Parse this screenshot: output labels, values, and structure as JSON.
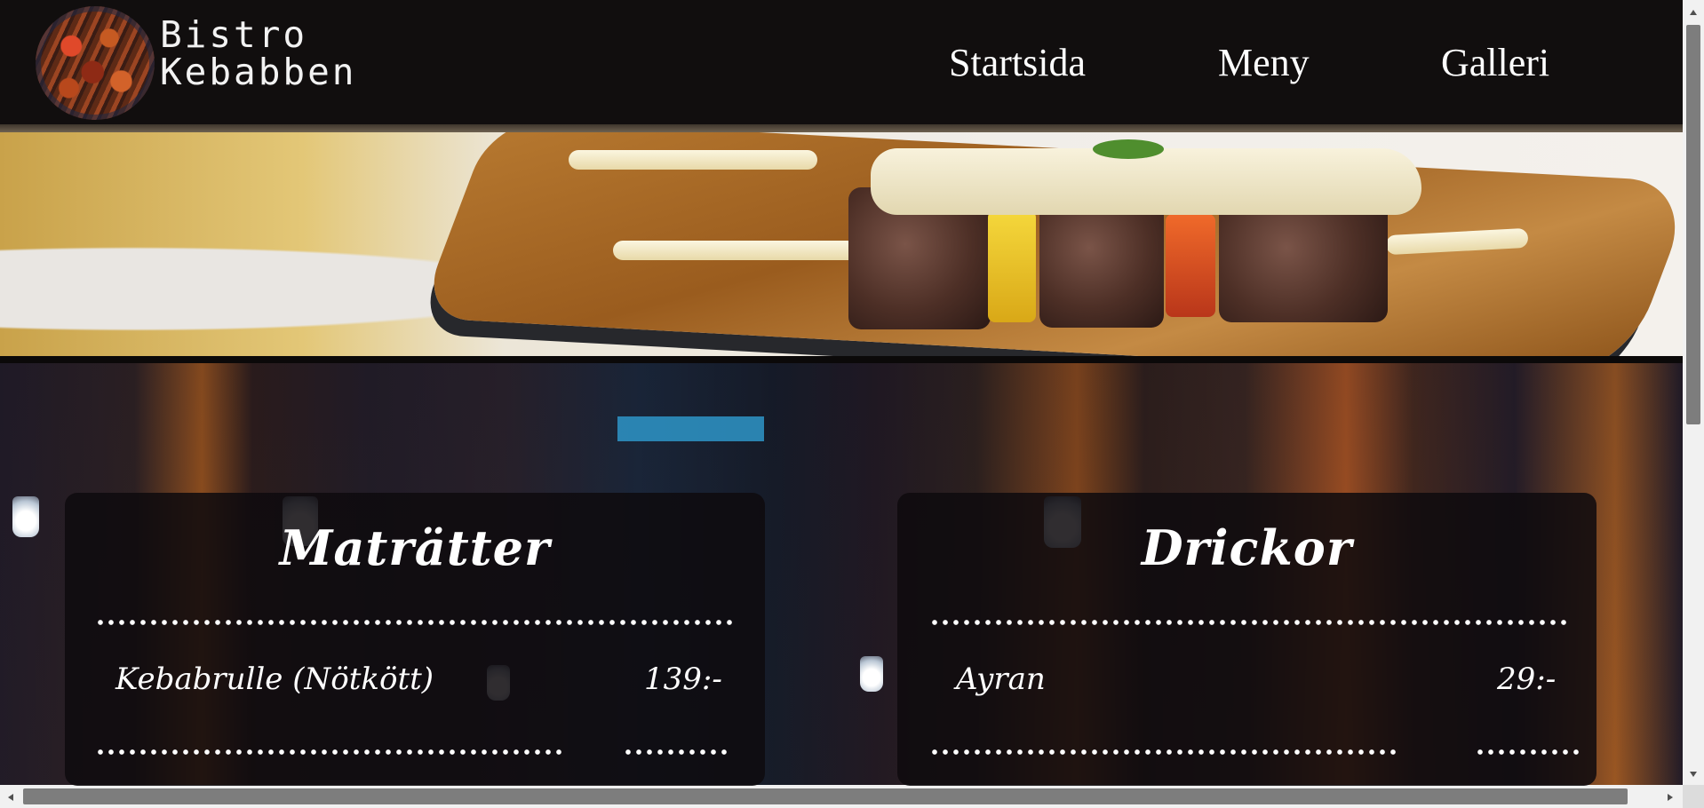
{
  "header": {
    "brand_line1": "Bistro",
    "brand_line2": "Kebabben",
    "nav": [
      {
        "label": "Startsida"
      },
      {
        "label": "Meny"
      },
      {
        "label": "Galleri"
      }
    ]
  },
  "menu": {
    "food": {
      "title": "Maträtter",
      "items": [
        {
          "name": "Kebabrulle (Nötkött)",
          "price": "139:-"
        }
      ]
    },
    "drinks": {
      "title": "Drickor",
      "items": [
        {
          "name": "Ayran",
          "price": "29:-"
        }
      ]
    }
  },
  "colors": {
    "header_bg": "#110e0e",
    "text": "#ffffff",
    "card_bg": "#0e0b0e"
  },
  "icons": {
    "logo": "kebab-grill-logo",
    "hero": "kebab-skewer-photo",
    "background": "night-alley-photo"
  }
}
